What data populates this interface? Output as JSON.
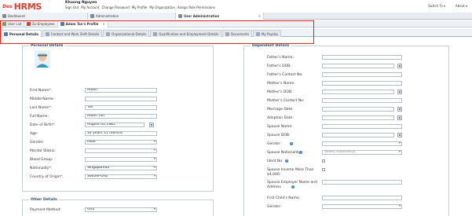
{
  "header": {
    "logo_prefix": "Des",
    "logo_text": "HRMS",
    "user_name": "Khuong Nguyen",
    "links": [
      "Sign Out",
      "My Account",
      "Change Password",
      "My Profile",
      "My Organization",
      "Assign Role Permissions"
    ],
    "switch_to": "Switch To ▾",
    "about": "About ▾"
  },
  "main_tabs": [
    {
      "label": "Dashboard"
    },
    {
      "label": "Administration"
    },
    {
      "label": "User Administration"
    }
  ],
  "sub_tabs": [
    {
      "label": "User List"
    },
    {
      "label": "Ex-Employees"
    },
    {
      "label": "Adam Tan's Profile"
    }
  ],
  "section_tabs": [
    {
      "label": "Personal Details"
    },
    {
      "label": "Contact and Work Shift Details"
    },
    {
      "label": "Organizational Details"
    },
    {
      "label": "Qualification and Employment Details"
    },
    {
      "label": "Documents"
    },
    {
      "label": "My Payslip"
    }
  ],
  "personal": {
    "title": "Personal Details",
    "first_name_label": "First Name*:",
    "first_name": "Adam",
    "middle_name_label": "Middle Name:",
    "middle_name": "",
    "last_name_label": "Last Name*:",
    "last_name": "Tan",
    "full_name_label": "Full Name:",
    "full_name": "Adam Tan",
    "dob_label": "Date of Birth*:",
    "dob": "August 01,1985",
    "age_label": "Age:",
    "age": "32 years 11 months",
    "gender_label": "Gender:",
    "gender": "Male",
    "marital_label": "Marital Status:",
    "marital": "",
    "blood_label": "Blood Group:",
    "blood": "",
    "nationality_label": "Nationality*:",
    "nationality": "Singaporean",
    "country_label": "Country of Origin*:",
    "country": "SINGAPORE"
  },
  "other": {
    "title": "Other Details",
    "payment_label": "Payment Method:",
    "payment": "Giro"
  },
  "dependent": {
    "title": "Dependent Details",
    "fields": [
      {
        "label": "Father's Name:",
        "value": "",
        "type": "text"
      },
      {
        "label": "Father's DOB:",
        "value": "",
        "type": "date"
      },
      {
        "label": "Father's Contact No:",
        "value": "",
        "type": "text"
      },
      {
        "label": "Mother's Name:",
        "value": "",
        "type": "text"
      },
      {
        "label": "Mother's DOB:",
        "value": "",
        "type": "date"
      },
      {
        "label": "Mother's Contact No:",
        "value": "",
        "type": "text"
      },
      {
        "label": "Marriage Date:",
        "value": "",
        "type": "date"
      },
      {
        "label": "Adoption Date:",
        "value": "",
        "type": "date"
      },
      {
        "label": "Spouse Name:",
        "value": "",
        "type": "text"
      },
      {
        "label": "Spouse DOB:",
        "value": "",
        "type": "date"
      },
      {
        "label": "Gender",
        "value": "",
        "type": "select"
      },
      {
        "label": "Spouse Nationality",
        "value": "Select nationality",
        "type": "select"
      },
      {
        "label": "Ident No",
        "value": "",
        "type": "check"
      },
      {
        "label": "Spouse Income More Than $4,000:",
        "value": "",
        "type": "check"
      },
      {
        "label": "Spouse Employer Name and Address",
        "value": "",
        "type": "text"
      },
      {
        "label": "First Child's Name:",
        "value": "",
        "type": "text"
      },
      {
        "label": "Gender:",
        "value": "",
        "type": "select"
      }
    ]
  },
  "colors": {
    "accent": "#e03a2f",
    "highlight": "#e0241b",
    "panel_title": "#2c4a6e"
  }
}
